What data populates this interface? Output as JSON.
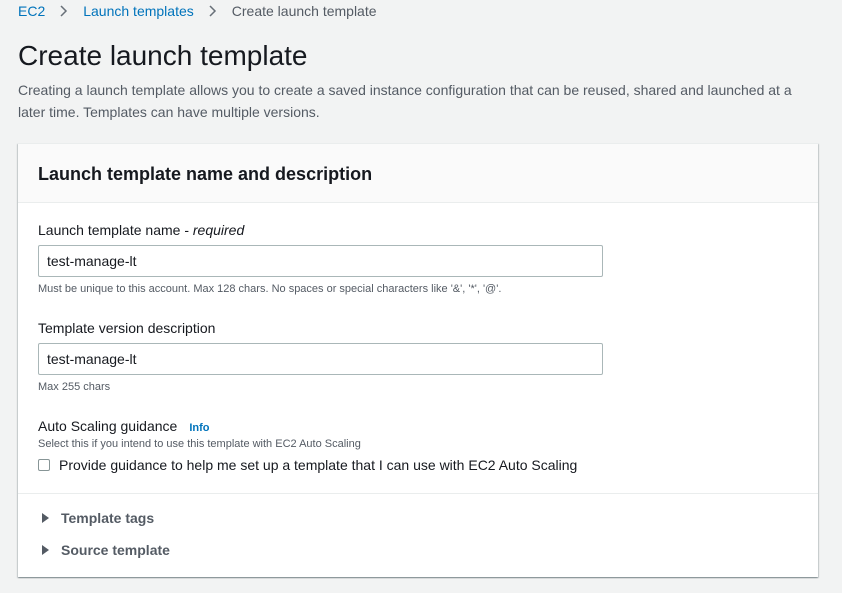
{
  "breadcrumb": {
    "items": [
      {
        "label": "EC2"
      },
      {
        "label": "Launch templates"
      },
      {
        "label": "Create launch template"
      }
    ]
  },
  "page": {
    "title": "Create launch template",
    "description": "Creating a launch template allows you to create a saved instance configuration that can be reused, shared and launched at a later time. Templates can have multiple versions."
  },
  "panel": {
    "title": "Launch template name and description",
    "name_field": {
      "label": "Launch template name - ",
      "required": "required",
      "value": "test-manage-lt",
      "hint": "Must be unique to this account. Max 128 chars. No spaces or special characters like '&', '*', '@'."
    },
    "description_field": {
      "label": "Template version description",
      "value": "test-manage-lt",
      "hint": "Max 255 chars"
    },
    "auto_scaling": {
      "label": "Auto Scaling guidance",
      "info": "Info",
      "hint": "Select this if you intend to use this template with EC2 Auto Scaling",
      "checkbox_label": "Provide guidance to help me set up a template that I can use with EC2 Auto Scaling",
      "checked": false
    },
    "expanders": [
      {
        "label": "Template tags"
      },
      {
        "label": "Source template"
      }
    ]
  },
  "colors": {
    "link": "#0073bb",
    "background": "#f2f3f3",
    "text": "#16191f",
    "secondary_text": "#545b64"
  },
  "icons": {
    "breadcrumb_separator": "chevron-right-icon",
    "expander": "caret-right-icon"
  }
}
